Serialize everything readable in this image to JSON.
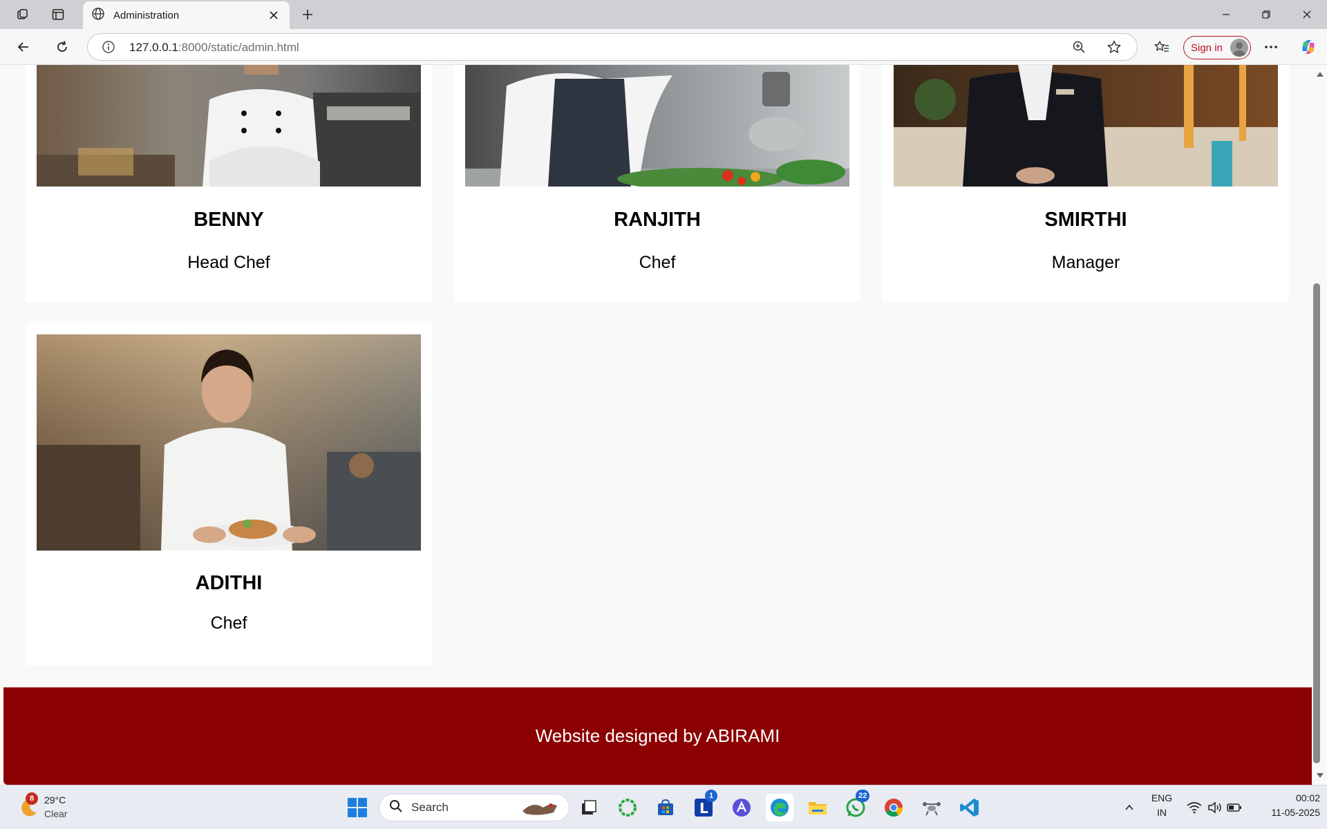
{
  "browser": {
    "tab_title": "Administration",
    "url_host": "127.0.0.1",
    "url_path": ":8000/static/admin.html",
    "signin_label": "Sign in"
  },
  "staff": [
    {
      "name": "BENNY",
      "role": "Head Chef"
    },
    {
      "name": "RANJITH",
      "role": "Chef"
    },
    {
      "name": "SMIRTHI",
      "role": "Manager"
    },
    {
      "name": "ADITHI",
      "role": "Chef"
    }
  ],
  "footer": {
    "text": "Website designed by ABIRAMI"
  },
  "taskbar": {
    "weather_temp": "29°C",
    "weather_desc": "Clear",
    "weather_badge": "8",
    "search_placeholder": "Search",
    "mail_badge": "1",
    "whatsapp_badge": "22",
    "lang_top": "ENG",
    "lang_bottom": "IN",
    "time": "00:02",
    "date": "11-05-2025"
  },
  "colors": {
    "footer_bg": "#8b0000",
    "signin_accent": "#b1141d",
    "page_bg": "#f9f9f9"
  }
}
